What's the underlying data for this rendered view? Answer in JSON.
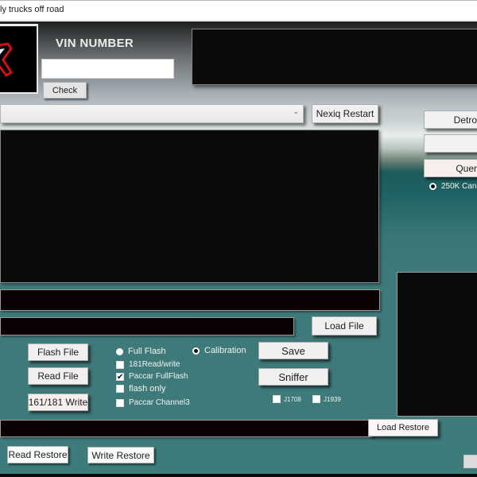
{
  "window": {
    "title": "ly trucks off road"
  },
  "header": {
    "logo": "logo-image",
    "vin_label": "VIN NUMBER",
    "vin_value": "",
    "check_button": "Check"
  },
  "toolbar": {
    "dropdown_value": "",
    "dropdown_icon": "chevron-down-icon",
    "dropdown_chevron": "⌄",
    "nexiq_restart_button": "Nexiq Restart"
  },
  "right_panel": {
    "detroit_button": "Detro",
    "blank_button": "",
    "query_button": "Quer",
    "can_radio_label": "250K Can",
    "can_radio_selected": true
  },
  "file": {
    "load_file_button": "Load File",
    "flash_file_button": "Flash File",
    "read_file_button": "Read File",
    "write_161_181_button": "161/181 Write",
    "save_button": "Save",
    "sniffer_button": "Sniffer"
  },
  "options": {
    "full_flash": {
      "label": "Full Flash",
      "selected": false
    },
    "calibration": {
      "label": "Calibration",
      "selected": true
    },
    "read_write_181": {
      "label": "181Read/write",
      "checked": false
    },
    "paccar_fullflash": {
      "label": "Paccar FullFlash",
      "checked": true,
      "mark": "✔"
    },
    "flash_only": {
      "label": "flash only",
      "checked": false
    },
    "paccar_channel3": {
      "label": "Paccar Channel3",
      "checked": false
    },
    "j1708": {
      "label": "J1708",
      "checked": false
    },
    "j1939": {
      "label": "J1939",
      "checked": false
    }
  },
  "restore": {
    "load_restore_button": "Load Restore",
    "read_restore_button": "Read Restore",
    "write_restore_button": "Write Restore"
  }
}
